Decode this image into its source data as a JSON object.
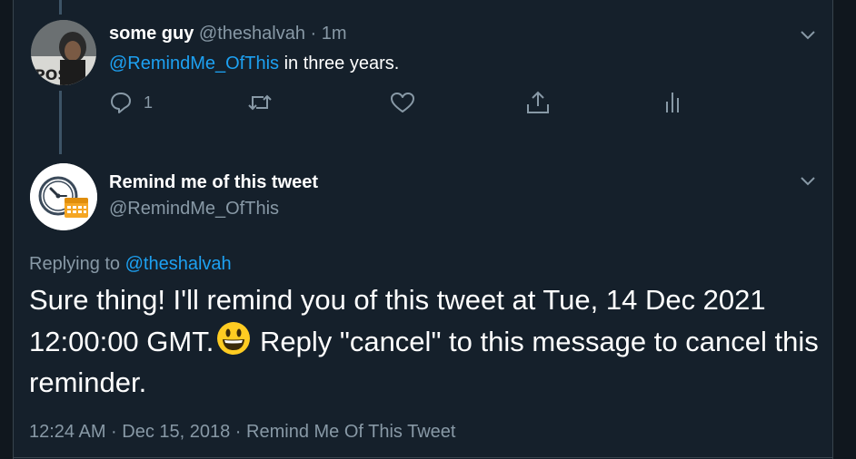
{
  "tweet1": {
    "display_name": "some guy",
    "handle": "@theshalvah",
    "separator": "·",
    "time": "1m",
    "mention": "@RemindMe_OfThis",
    "text": " in three years.",
    "reply_count": "1"
  },
  "tweet2": {
    "display_name": "Remind me of this tweet",
    "handle": "@RemindMe_OfThis",
    "replying_label": "Replying to ",
    "replying_handle": "@theshalvah",
    "text_part1": "Sure thing! I'll remind you of this tweet at Tue, 14 Dec 2021 12:00:00 GMT.",
    "text_part2": " Reply \"cancel\" to this message to cancel this reminder.",
    "timestamp": "12:24 AM · Dec 15, 2018 · Remind Me Of This Tweet"
  },
  "colors": {
    "background": "#15202b",
    "accent": "#1da1f2",
    "muted": "#8899a6"
  },
  "icons": [
    "reply-icon",
    "retweet-icon",
    "like-icon",
    "share-icon",
    "analytics-icon",
    "chevron-down-icon",
    "clock-calendar-avatar",
    "smiley-emoji"
  ]
}
